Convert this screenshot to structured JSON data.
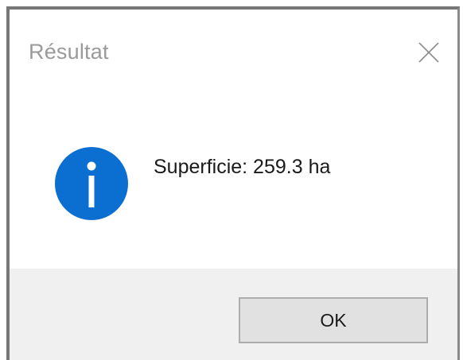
{
  "dialog": {
    "title": "Résultat",
    "close_icon": "close-icon",
    "icon": "info-icon",
    "message": "Superficie: 259.3 ha",
    "ok_label": "OK"
  },
  "colors": {
    "icon_blue": "#0a6fd1",
    "footer_bg": "#f0f0f0",
    "button_bg": "#e1e1e1",
    "button_border": "#adadad",
    "title_text": "#9a9a9a"
  }
}
